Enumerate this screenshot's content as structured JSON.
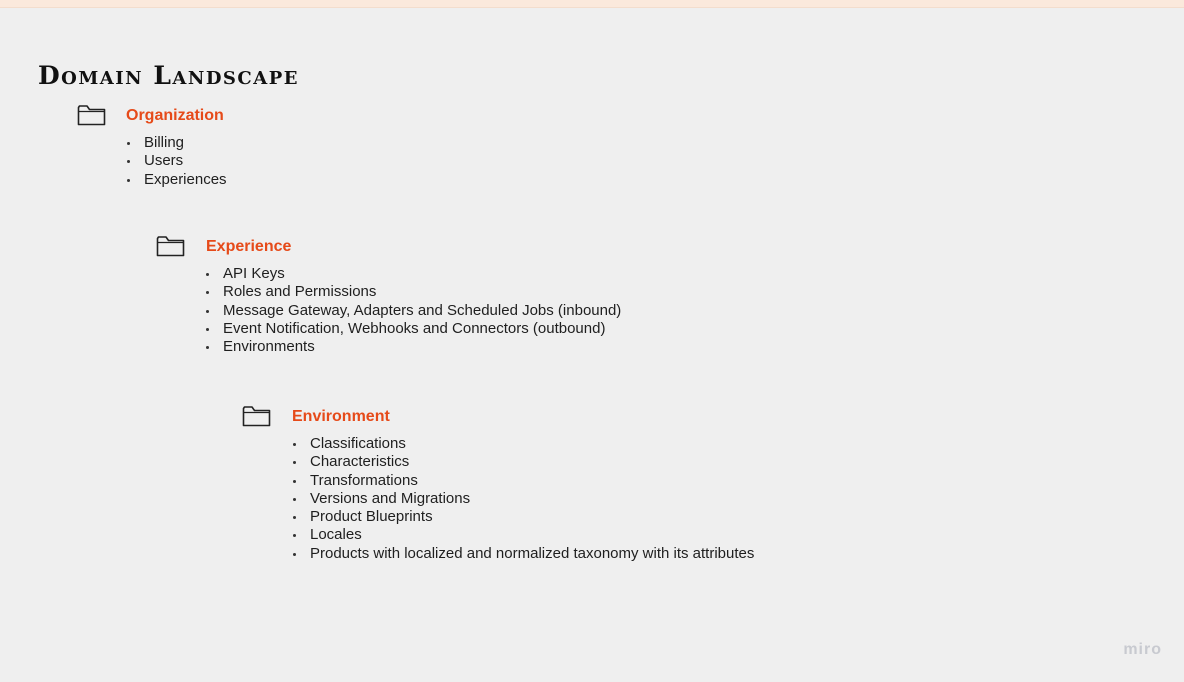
{
  "title": "Domain Landscape",
  "sections": [
    {
      "title": "Organization",
      "icon": "folder-icon",
      "items": [
        "Billing",
        "Users",
        "Experiences"
      ]
    },
    {
      "title": "Experience",
      "icon": "folder-icon",
      "items": [
        "API Keys",
        "Roles and Permissions",
        "Message Gateway, Adapters and Scheduled Jobs (inbound)",
        "Event Notification, Webhooks and Connectors (outbound)",
        "Environments"
      ]
    },
    {
      "title": "Environment",
      "icon": "folder-icon",
      "items": [
        "Classifications",
        "Characteristics",
        "Transformations",
        "Versions and Migrations",
        "Product Blueprints",
        "Locales",
        "Products with localized and normalized taxonomy with its attributes"
      ]
    }
  ],
  "watermark": "miro",
  "colors": {
    "accent": "#e64a19",
    "background": "#efefef",
    "text": "#1e1e1e"
  }
}
